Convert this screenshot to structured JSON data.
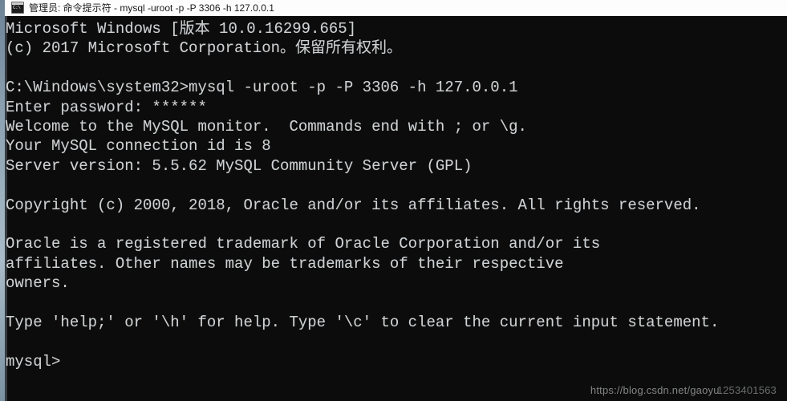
{
  "window": {
    "title": "管理员: 命令提示符 - mysql  -uroot -p -P 3306 -h 127.0.0.1",
    "icon": "cmd-icon",
    "background_color": "#0c0c0c",
    "text_color": "#cfd2d4",
    "titlebar_color": "#fdfdfd"
  },
  "console": {
    "lines": [
      "Microsoft Windows [版本 10.0.16299.665]",
      "(c) 2017 Microsoft Corporation。保留所有权利。",
      "",
      "C:\\Windows\\system32>mysql -uroot -p -P 3306 -h 127.0.0.1",
      "Enter password: ******",
      "Welcome to the MySQL monitor.  Commands end with ; or \\g.",
      "Your MySQL connection id is 8",
      "Server version: 5.5.62 MySQL Community Server (GPL)",
      "",
      "Copyright (c) 2000, 2018, Oracle and/or its affiliates. All rights reserved.",
      "",
      "Oracle is a registered trademark of Oracle Corporation and/or its",
      "affiliates. Other names may be trademarks of their respective",
      "owners.",
      "",
      "Type 'help;' or '\\h' for help. Type '\\c' to clear the current input statement.",
      "",
      "mysql>"
    ]
  },
  "watermark": {
    "base": "https://blog.csdn.net/gaoyu",
    "overlap": "1253401563"
  }
}
